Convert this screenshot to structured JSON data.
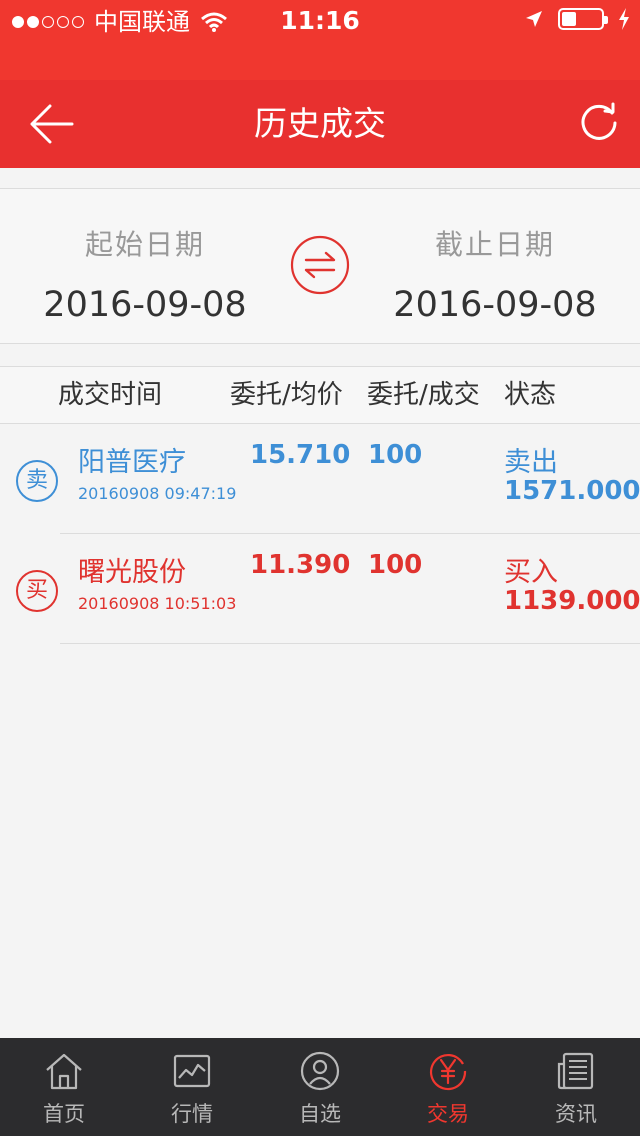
{
  "status_bar": {
    "carrier": "中国联通",
    "time": "11:16"
  },
  "navbar": {
    "title": "历史成交"
  },
  "date_range": {
    "start_label": "起始日期",
    "start_value": "2016-09-08",
    "end_label": "截止日期",
    "end_value": "2016-09-08"
  },
  "list_header": {
    "col1": "成交时间",
    "col2": "委托/均价",
    "col3": "委托/成交",
    "col4": "状态"
  },
  "trades": [
    {
      "badge": "卖",
      "name": "阳普医疗",
      "datetime": "20160908 09:47:19",
      "price": "15.710",
      "qty": "100",
      "status": "卖出",
      "amount": "1571.000",
      "color": "#3e8fd6"
    },
    {
      "badge": "买",
      "name": "曙光股份",
      "datetime": "20160908 10:51:03",
      "price": "11.390",
      "qty": "100",
      "status": "买入",
      "amount": "1139.000",
      "color": "#e0332f"
    }
  ],
  "tabbar": {
    "tabs": [
      {
        "label": "首页",
        "icon": "home-icon"
      },
      {
        "label": "行情",
        "icon": "chart-icon"
      },
      {
        "label": "自选",
        "icon": "user-icon"
      },
      {
        "label": "交易",
        "icon": "yen-icon"
      },
      {
        "label": "资讯",
        "icon": "news-icon"
      }
    ],
    "active_index": 3
  },
  "colors": {
    "brand_red": "#e8302f",
    "sell_blue": "#3e8fd6",
    "buy_red": "#e0332f",
    "tabbar_bg": "#2c2c2e"
  }
}
